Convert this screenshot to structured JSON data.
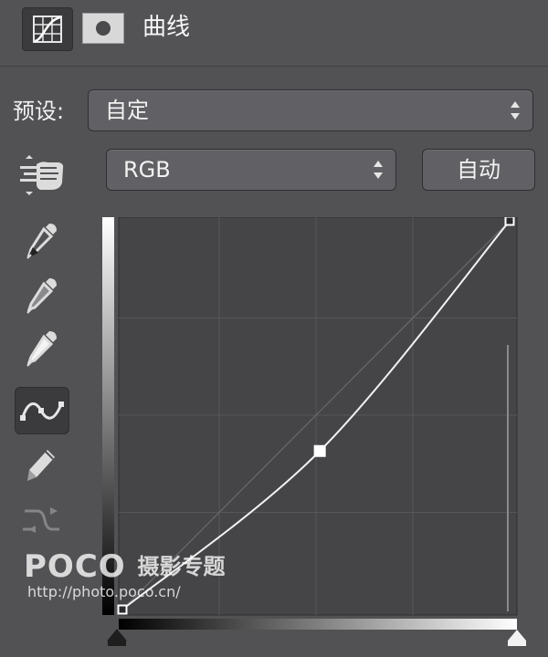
{
  "header": {
    "title": "曲线",
    "curves_icon": "curves-adjustment-icon",
    "mask_icon": "layer-mask-icon"
  },
  "preset": {
    "label": "预设:",
    "value": "自定"
  },
  "channel": {
    "value": "RGB"
  },
  "auto_button": {
    "label": "自动"
  },
  "tools": [
    "on-image-adjust-icon",
    "black-point-eyedropper-icon",
    "gray-point-eyedropper-icon",
    "white-point-eyedropper-icon",
    "edit-points-icon",
    "pencil-icon",
    "smooth-curve-icon"
  ],
  "curve": {
    "input_range": [
      0,
      255
    ],
    "output_range": [
      0,
      255
    ],
    "points": [
      {
        "input": 0,
        "output": 0
      },
      {
        "input": 130,
        "output": 104
      },
      {
        "input": 255,
        "output": 255
      }
    ]
  },
  "colors": {
    "panel_bg": "#525154",
    "graph_bg": "#454447",
    "curve": "#f2f2f2"
  },
  "watermark": {
    "brand": "POCO",
    "title": "摄影专题",
    "url": "http://photo.poco.cn/"
  }
}
